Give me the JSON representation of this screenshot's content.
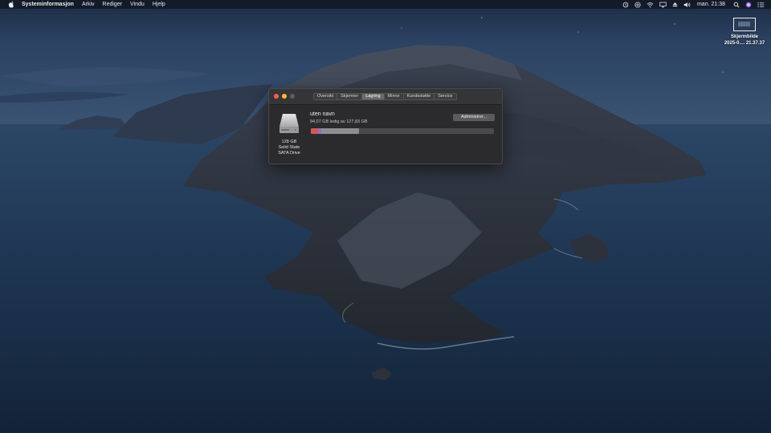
{
  "menubar": {
    "app_name": "Systeminformasjon",
    "menus": [
      "Arkiv",
      "Rediger",
      "Vindu",
      "Hjelp"
    ],
    "clock": "man. 21:38",
    "status_icons": [
      "time-machine-icon",
      "audio-input-icon",
      "wifi-icon",
      "display-mirror-icon",
      "eject-icon",
      "volume-icon",
      "search-icon",
      "siri-icon",
      "control-list-icon"
    ]
  },
  "desktop": {
    "file_name_line1": "Skjermbilde",
    "file_name_line2": "2025-0.... 21.37.37"
  },
  "window": {
    "tabs": [
      {
        "label": "Oversikt",
        "active": false
      },
      {
        "label": "Skjermer",
        "active": false
      },
      {
        "label": "Lagring",
        "active": true
      },
      {
        "label": "Minne",
        "active": false
      },
      {
        "label": "Kundestøtte",
        "active": false
      },
      {
        "label": "Service",
        "active": false
      }
    ],
    "disk": {
      "caption_1": "128 GB",
      "caption_2": "Solid State",
      "caption_3": "SATA Drive"
    },
    "volume": {
      "name": "uten navn",
      "free_text": "94,07 GB ledig av 127,83 GB"
    },
    "manage_button": "Administrer...",
    "storage_bar": {
      "total_gb": 127.83,
      "segments": [
        {
          "fraction": 0.04,
          "color": "#d05a5a"
        },
        {
          "fraction": 0.015,
          "color": "#9c6fb0"
        },
        {
          "fraction": 0.21,
          "color": "#8e8e92"
        }
      ]
    }
  },
  "colors": {
    "window_bg": "#2b2b2d",
    "active_tab": "#6a6a6d",
    "close": "#ff5f57",
    "minimize": "#febc2e"
  }
}
